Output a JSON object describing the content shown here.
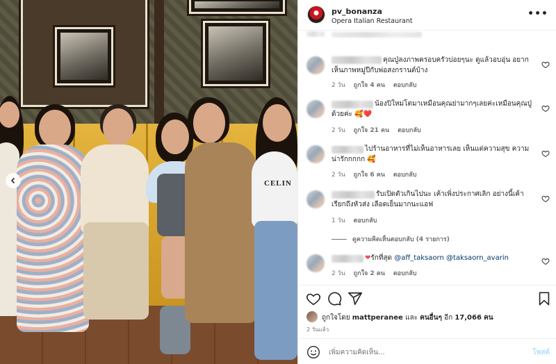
{
  "post": {
    "username": "pv_bonanza",
    "location": "Opera Italian Restaurant",
    "more_label": "•••"
  },
  "comments": [
    {
      "text": "คุณปู่ลงภาพครอบครัวบ่อยๆนะ ดูแล้วอบอุ่น อยากเห็นภาพหมู่ปีกับพ่อสงกรานต์บ้าง",
      "time": "2 วัน",
      "likes": "ถูกใจ 4 คน",
      "reply": "ตอบกลับ"
    },
    {
      "text": "น้องปิใหม่โตมาเหมือนคุณย่ามากๆเลยค่ะเหมือนคุณปู่ด้วยค่ะ",
      "emoji": "🥰❤️",
      "time": "2 วัน",
      "likes": "ถูกใจ 21 คน",
      "reply": "ตอบกลับ"
    },
    {
      "text": "ไปร้านอาหารที่ไม่เห็นอาหารเลย เห็นแต่ความสุข ความน่ารักกกกก",
      "emoji": "🥰",
      "time": "2 วัน",
      "likes": "ถูกใจ 6 คน",
      "reply": "ตอบกลับ"
    },
    {
      "text": "รับเปิดตัวเกินไปนะ เค้าเพิ่งประกาศเลิก อย่างนี้เค้าเรียกถึงหัวส่ง เลือดเย็นมากนะแอฟ",
      "time": "1 วัน",
      "reply": "ตอบกลับ",
      "view_replies": "ดูความคิดเห็นตอบกลับ (4 รายการ)"
    },
    {
      "text": "รักที่สุด",
      "mention1": "@aff_taksaorn",
      "mention2": "@taksaorn_avarin",
      "time": "2 วัน",
      "likes": "ถูกใจ 2 คน",
      "reply": "ตอบกลับ"
    }
  ],
  "likes": {
    "prefix": "ถูกใจโดย",
    "user": "mattperanee",
    "mid": "และ",
    "others": "คนอื่นๆ",
    "more": "อีก",
    "count": "17,066",
    "unit": "คน"
  },
  "date": "2 วันแล้ว",
  "add_comment": {
    "placeholder": "เพิ่มความคิดเห็น...",
    "post_label": "โพสต์"
  },
  "photo": {
    "tshirt_text": "CELIN"
  },
  "colors": {
    "link": "#00376b",
    "secondary_text": "#737373",
    "post_disabled": "#b2dffc",
    "heart_red": "#ed4956",
    "sofa": "#d9a52c"
  },
  "icons": [
    "carousel-prev-icon",
    "more-options-icon",
    "heart-icon",
    "comment-icon",
    "share-icon",
    "bookmark-icon",
    "emoji-icon"
  ]
}
